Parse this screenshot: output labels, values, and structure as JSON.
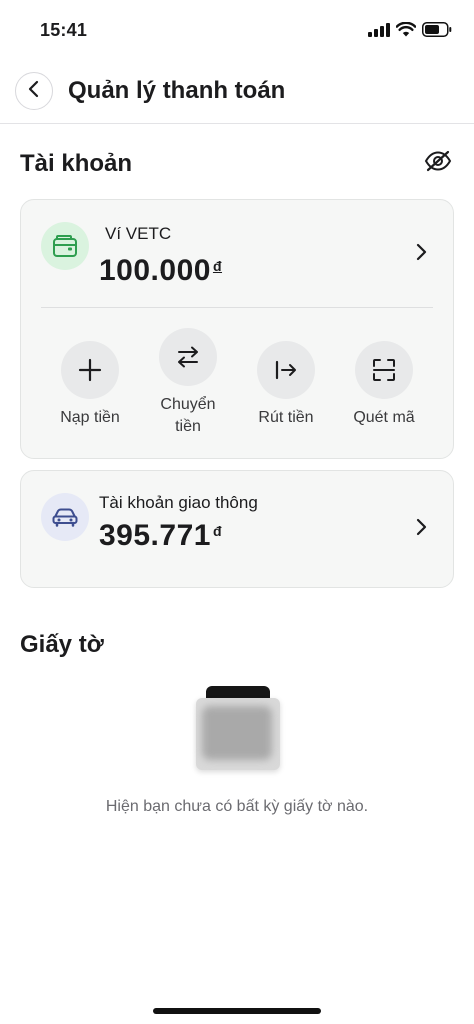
{
  "status_bar": {
    "time": "15:41"
  },
  "header": {
    "title": "Quản lý thanh toán"
  },
  "accounts": {
    "section_title": "Tài khoản",
    "wallet": {
      "name": "Ví VETC",
      "balance": "100.000",
      "currency_symbol": "đ",
      "actions": [
        {
          "label": "Nạp tiền",
          "icon": "plus-icon"
        },
        {
          "label": "Chuyển\ntiền",
          "icon": "transfer-icon"
        },
        {
          "label": "Rút tiền",
          "icon": "withdraw-icon"
        },
        {
          "label": "Quét mã",
          "icon": "scan-icon"
        }
      ]
    },
    "traffic": {
      "name": "Tài khoản giao thông",
      "balance": "395.771",
      "currency_symbol": "đ"
    }
  },
  "documents": {
    "section_title": "Giấy tờ",
    "empty_message": "Hiện bạn chưa có bất kỳ giấy tờ nào."
  },
  "colors": {
    "wallet_icon_bg": "#daf3df",
    "wallet_icon": "#2e9e4f",
    "traffic_icon_bg": "#e6e9f6",
    "traffic_icon": "#3d4d8f",
    "card_bg": "#f6f7f6"
  }
}
